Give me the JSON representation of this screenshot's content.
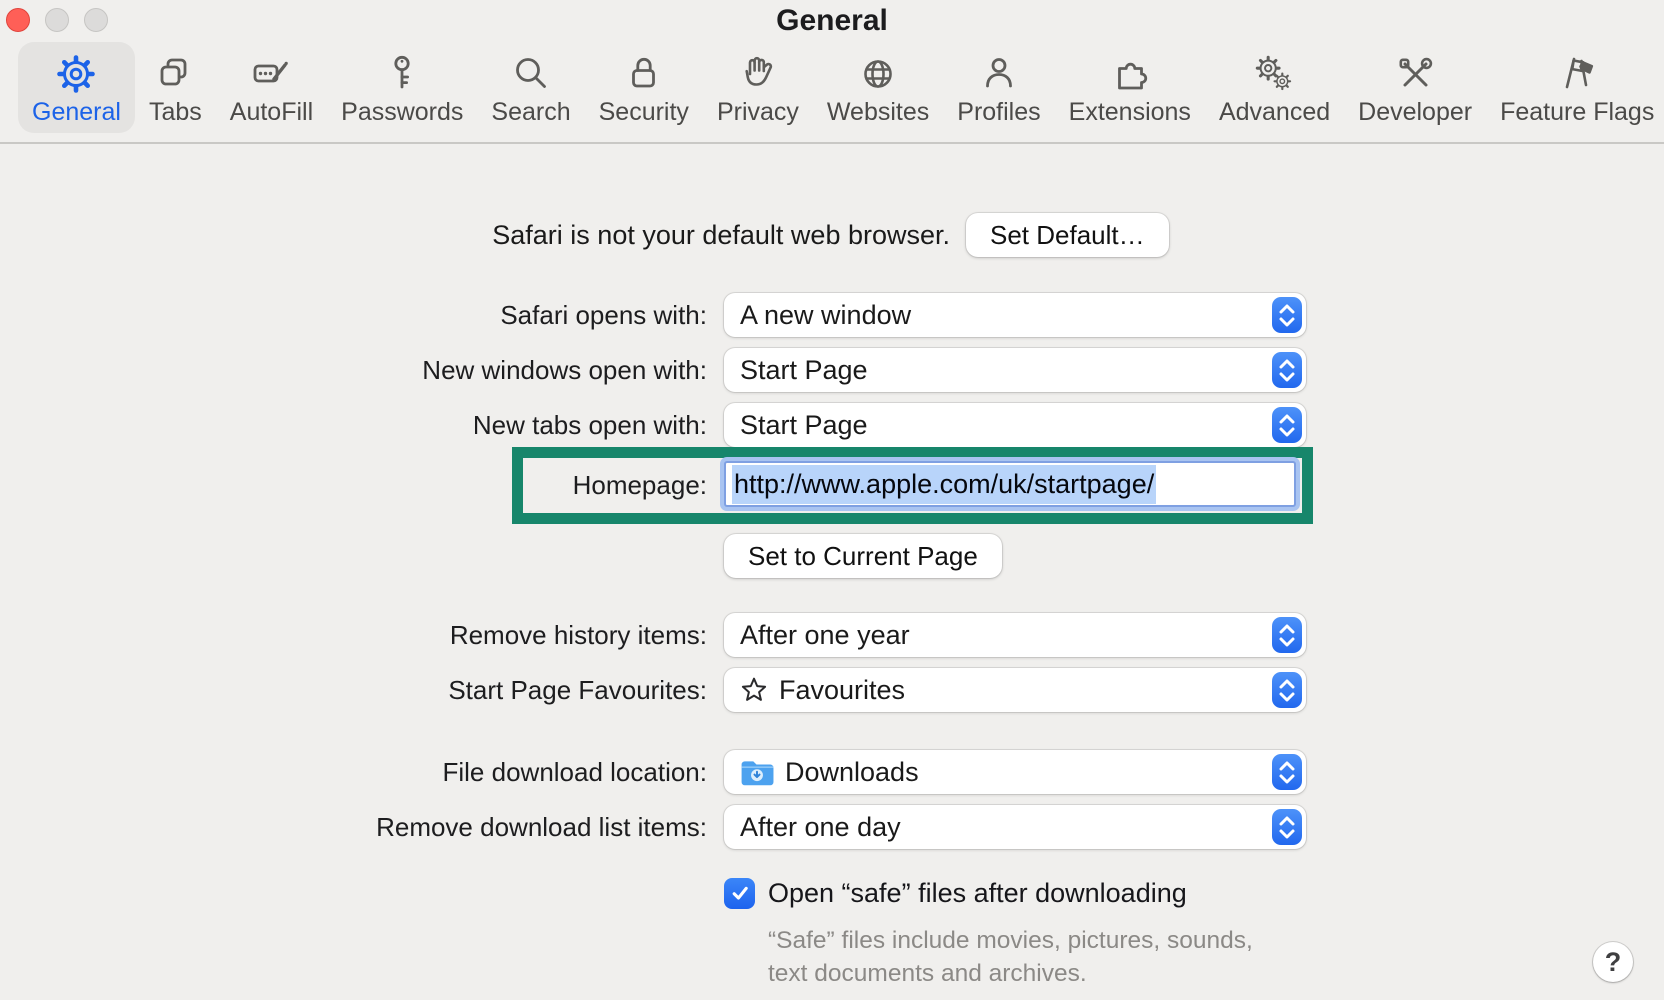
{
  "window": {
    "title": "General"
  },
  "toolbar": {
    "items": [
      {
        "label": "General",
        "icon": "gear-icon",
        "selected": true
      },
      {
        "label": "Tabs",
        "icon": "tabs-icon",
        "selected": false
      },
      {
        "label": "AutoFill",
        "icon": "autofill-card-icon",
        "selected": false
      },
      {
        "label": "Passwords",
        "icon": "key-icon",
        "selected": false
      },
      {
        "label": "Search",
        "icon": "magnifier-icon",
        "selected": false
      },
      {
        "label": "Security",
        "icon": "lock-icon",
        "selected": false
      },
      {
        "label": "Privacy",
        "icon": "hand-icon",
        "selected": false
      },
      {
        "label": "Websites",
        "icon": "globe-icon",
        "selected": false
      },
      {
        "label": "Profiles",
        "icon": "person-icon",
        "selected": false
      },
      {
        "label": "Extensions",
        "icon": "puzzle-icon",
        "selected": false
      },
      {
        "label": "Advanced",
        "icon": "double-gear-icon",
        "selected": false
      },
      {
        "label": "Developer",
        "icon": "tools-icon",
        "selected": false
      },
      {
        "label": "Feature Flags",
        "icon": "flags-icon",
        "selected": false
      }
    ]
  },
  "default_browser": {
    "message": "Safari is not your default web browser.",
    "set_default_button": "Set Default…"
  },
  "settings": {
    "safari_opens_with": {
      "label": "Safari opens with:",
      "value": "A new window"
    },
    "new_windows_open_with": {
      "label": "New windows open with:",
      "value": "Start Page"
    },
    "new_tabs_open_with": {
      "label": "New tabs open with:",
      "value": "Start Page"
    },
    "homepage": {
      "label": "Homepage:",
      "value": "http://www.apple.com/uk/startpage/",
      "selected_text": true
    },
    "set_to_current_page_button": "Set to Current Page",
    "remove_history_items": {
      "label": "Remove history items:",
      "value": "After one year"
    },
    "start_page_favourites": {
      "label": "Start Page Favourites:",
      "value": "Favourites",
      "icon": "star-icon"
    },
    "file_download_location": {
      "label": "File download location:",
      "value": "Downloads",
      "icon": "downloads-folder-icon"
    },
    "remove_download_list_items": {
      "label": "Remove download list items:",
      "value": "After one day"
    },
    "open_safe_files": {
      "label": "Open “safe” files after downloading",
      "checked": true,
      "note_line1": "“Safe” files include movies, pictures, sounds,",
      "note_line2": "text documents and archives."
    }
  },
  "help_button": "?",
  "colors": {
    "accent_blue": "#1c63e8",
    "annotation_green": "#17866B",
    "selection_blue": "#b8d4fa",
    "stepper_blue": "#2f7cf6",
    "close_light_red": "#ff5f57",
    "window_background": "#f0efed"
  }
}
